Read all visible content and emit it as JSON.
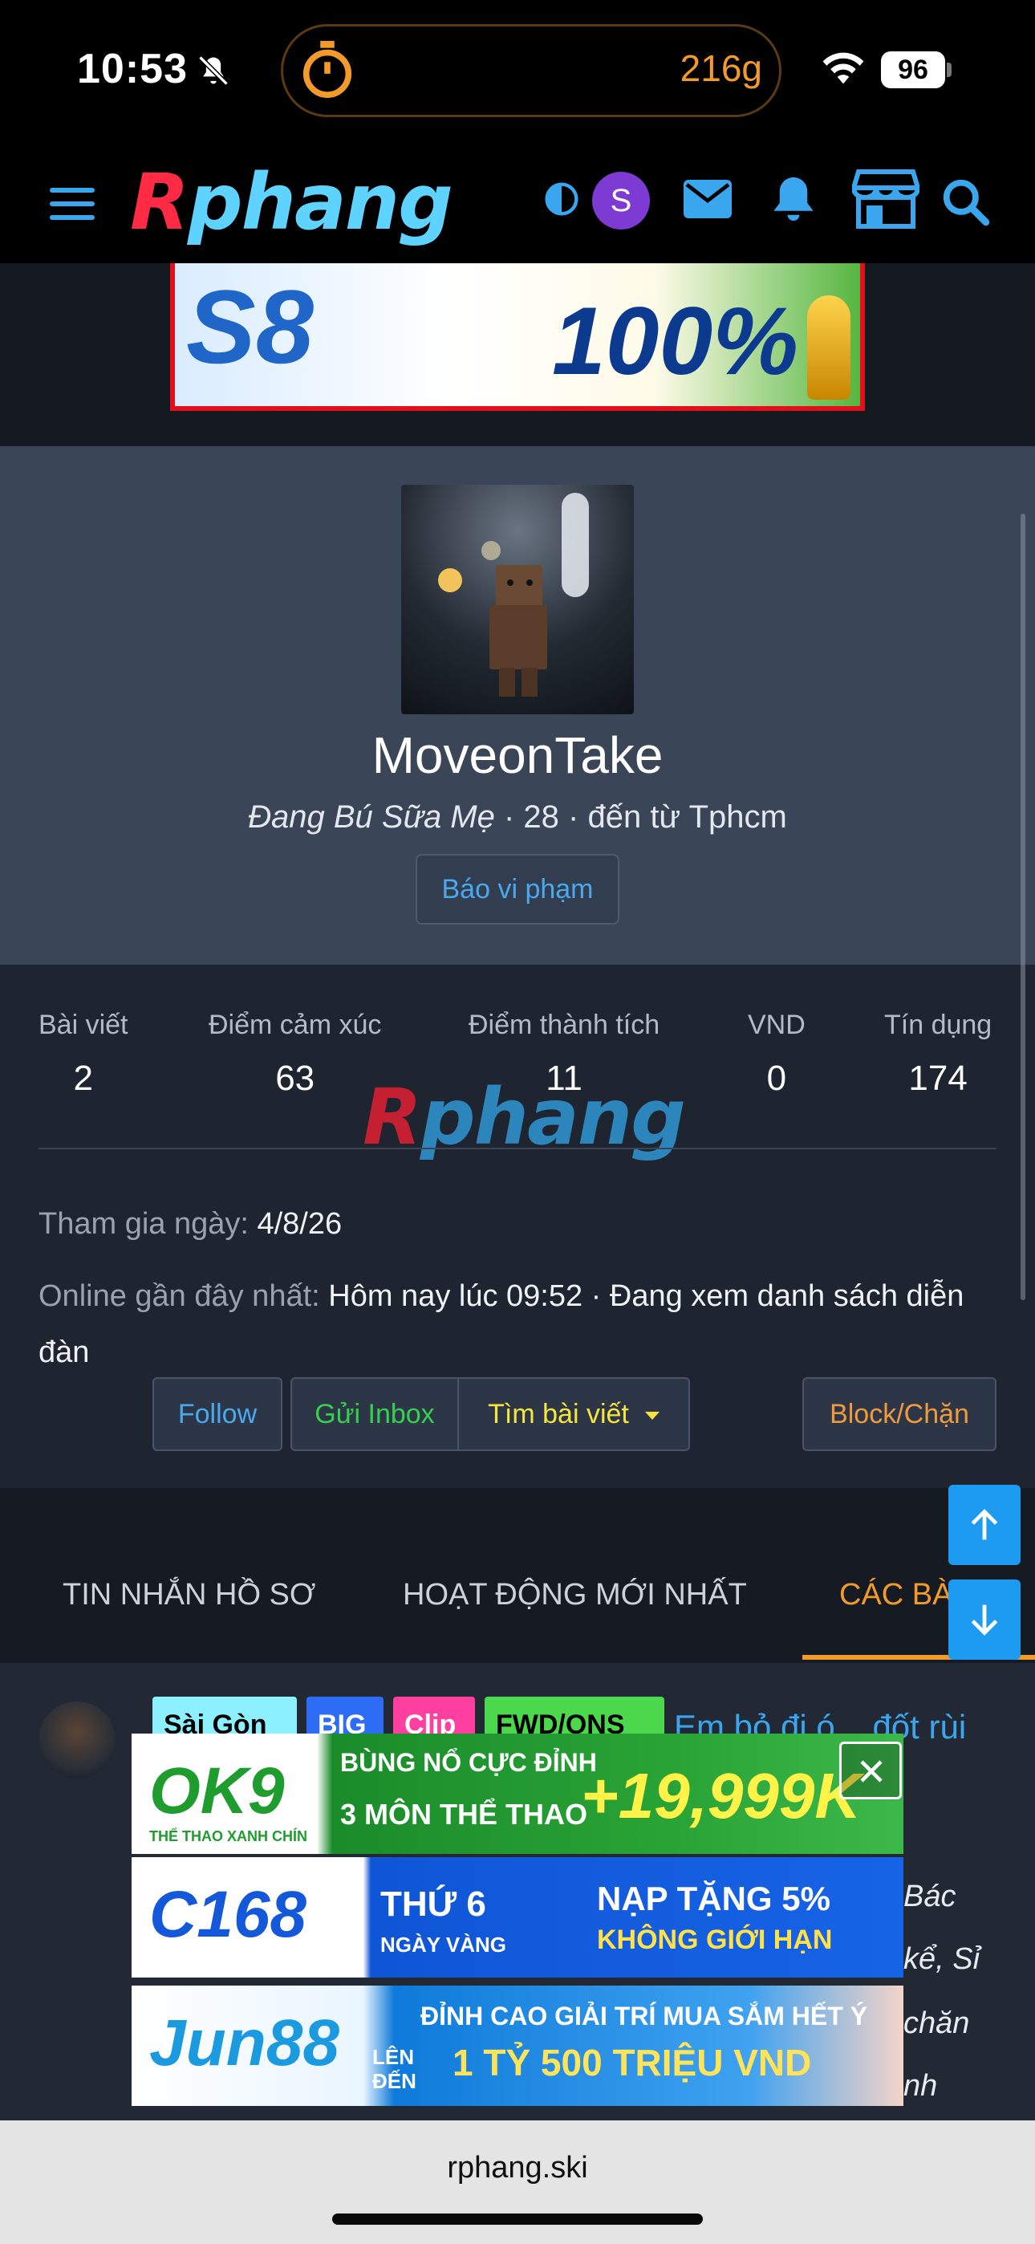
{
  "status_bar": {
    "time": "10:53",
    "island_text": "216g",
    "battery": "96"
  },
  "header": {
    "logo_part1": "R",
    "logo_part2": "phang",
    "avatar_letter": "S"
  },
  "banner_top": {
    "brand": "S8",
    "headline": "100%"
  },
  "profile": {
    "username": "MoveonTake",
    "title": "Đang Bú Sữa Mẹ",
    "meta_rest": " · 28 · đến từ Tphcm",
    "report_label": "Báo vi phạm"
  },
  "stats": [
    {
      "label": "Bài viết",
      "value": "2"
    },
    {
      "label": "Điểm cảm xúc",
      "value": "63"
    },
    {
      "label": "Điểm thành tích",
      "value": "11"
    },
    {
      "label": "VND",
      "value": "0"
    },
    {
      "label": "Tín dụng",
      "value": "174"
    }
  ],
  "watermark": {
    "part1": "R",
    "part2": "phang"
  },
  "info": {
    "join_label": "Tham gia ngày:",
    "join_value": "4/8/26",
    "online_label": "Online gần đây nhất:",
    "online_value": "Hôm nay lúc 09:52 · Đang xem danh sách diễn đàn"
  },
  "actions": {
    "follow": "Follow",
    "inbox": "Gửi Inbox",
    "find_posts": "Tìm bài viết",
    "block": "Block/Chặn"
  },
  "tabs": [
    {
      "label": "TIN NHẮN HỒ SƠ"
    },
    {
      "label": "HOẠT ĐỘNG MỚI NHẤT"
    },
    {
      "label": "CÁC BÀ"
    }
  ],
  "post": {
    "tags": [
      "Sài Gòn",
      "BIG",
      "Clip",
      "FWD/ONS"
    ],
    "title_visible": "Em bỏ đi ó... đốt rùi",
    "snippet_lines": [
      "Bác",
      "kể, Sỉ",
      "chăn",
      "nh"
    ]
  },
  "ads": {
    "ok9": {
      "brand": "OK9",
      "tagline": "THỂ THAO XANH CHÍN",
      "line1": "BÙNG NỔ CỰC ĐỈNH",
      "line2": "3 MÔN THỂ THAO",
      "amount": "+19,999K"
    },
    "c168": {
      "brand": "C168",
      "line1": "THỨ 6",
      "line2": "NGÀY VÀNG",
      "promo1": "NẠP TẶNG 5%",
      "promo2": "KHÔNG GIỚI HẠN"
    },
    "jun88": {
      "brand": "Jun88",
      "line1": "ĐỈNH CAO GIẢI TRÍ MUA SẮM HẾT Ý",
      "line2": "LÊN ĐẾN",
      "amount": "1 TỶ 500 TRIỆU VND"
    }
  },
  "browser": {
    "url": "rphang.ski"
  },
  "colors": {
    "accent_orange": "#f29a2a",
    "link_blue": "#4aa8ee",
    "inbox_green": "#35d04e",
    "find_yellow": "#f7e43c",
    "scroll_button_blue": "#1d9bf0"
  }
}
